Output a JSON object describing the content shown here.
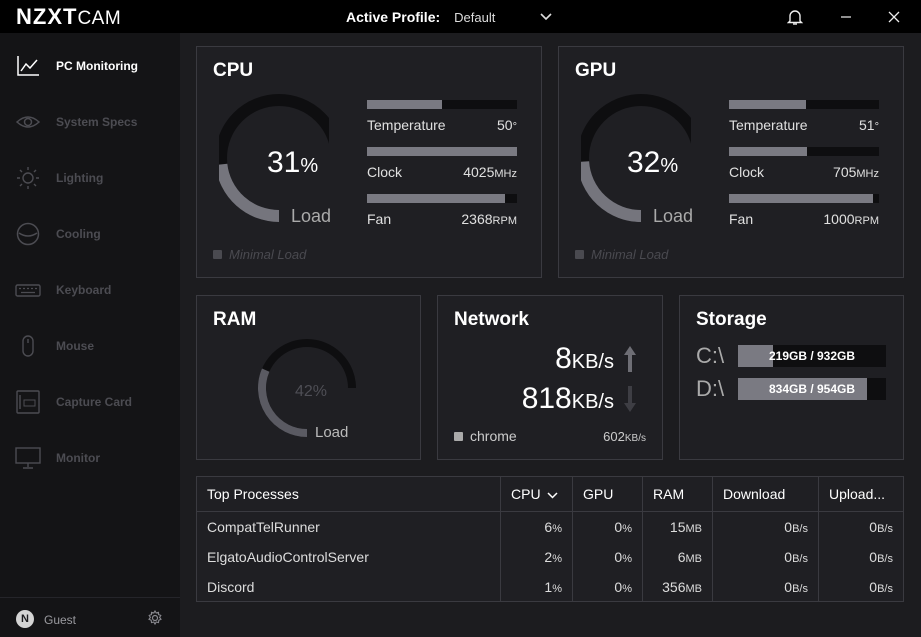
{
  "app": {
    "brand_bold": "NZXT",
    "brand_light": "CAM"
  },
  "profile": {
    "label": "Active Profile:",
    "value": "Default"
  },
  "sidebar": {
    "items": [
      {
        "label": "PC Monitoring",
        "icon": "chart-line-icon",
        "active": true
      },
      {
        "label": "System Specs",
        "icon": "eye-icon",
        "active": false
      },
      {
        "label": "Lighting",
        "icon": "sun-icon",
        "active": false
      },
      {
        "label": "Cooling",
        "icon": "cooling-icon",
        "active": false
      },
      {
        "label": "Keyboard",
        "icon": "keyboard-icon",
        "active": false
      },
      {
        "label": "Mouse",
        "icon": "mouse-icon",
        "active": false
      },
      {
        "label": "Capture Card",
        "icon": "capture-card-icon",
        "active": false
      },
      {
        "label": "Monitor",
        "icon": "monitor-icon",
        "active": false
      }
    ],
    "user": {
      "initial": "N",
      "name": "Guest"
    }
  },
  "cpu": {
    "title": "CPU",
    "load_value": "31",
    "load_unit": "%",
    "load_label": "Load",
    "load_fraction": 0.31,
    "temperature": {
      "label": "Temperature",
      "value": "50",
      "unit": "°",
      "fraction": 0.5
    },
    "clock": {
      "label": "Clock",
      "value": "4025",
      "unit": "MHz",
      "fraction": 1.0
    },
    "fan": {
      "label": "Fan",
      "value": "2368",
      "unit": "RPM",
      "fraction": 0.92
    },
    "mode": "Minimal Load"
  },
  "gpu": {
    "title": "GPU",
    "load_value": "32",
    "load_unit": "%",
    "load_label": "Load",
    "load_fraction": 0.32,
    "temperature": {
      "label": "Temperature",
      "value": "51",
      "unit": "°",
      "fraction": 0.51
    },
    "clock": {
      "label": "Clock",
      "value": "705",
      "unit": "MHz",
      "fraction": 0.52
    },
    "fan": {
      "label": "Fan",
      "value": "1000",
      "unit": "RPM",
      "fraction": 0.96
    },
    "mode": "Minimal Load"
  },
  "ram": {
    "title": "RAM",
    "load_value": "42%",
    "load_label": "Load",
    "load_fraction": 0.42
  },
  "network": {
    "title": "Network",
    "upload_value": "8",
    "upload_unit": "KB/s",
    "download_value": "818",
    "download_unit": "KB/s",
    "top_process": "chrome",
    "top_process_value": "602",
    "top_process_unit": "KB/s"
  },
  "storage": {
    "title": "Storage",
    "drives": [
      {
        "label": "C:\\",
        "text": "219GB / 932GB",
        "fraction": 0.235
      },
      {
        "label": "D:\\",
        "text": "834GB / 954GB",
        "fraction": 0.874
      }
    ]
  },
  "processes": {
    "headers": {
      "name": "Top Processes",
      "cpu": "CPU",
      "gpu": "GPU",
      "ram": "RAM",
      "download": "Download",
      "upload": "Upload..."
    },
    "rows": [
      {
        "name": "CompatTelRunner",
        "cpu": "6",
        "cpu_u": "%",
        "gpu": "0",
        "gpu_u": "%",
        "ram": "15",
        "ram_u": "MB",
        "down": "0",
        "down_u": "B/s",
        "up": "0",
        "up_u": "B/s"
      },
      {
        "name": "ElgatoAudioControlServer",
        "cpu": "2",
        "cpu_u": "%",
        "gpu": "0",
        "gpu_u": "%",
        "ram": "6",
        "ram_u": "MB",
        "down": "0",
        "down_u": "B/s",
        "up": "0",
        "up_u": "B/s"
      },
      {
        "name": "Discord",
        "cpu": "1",
        "cpu_u": "%",
        "gpu": "0",
        "gpu_u": "%",
        "ram": "356",
        "ram_u": "MB",
        "down": "0",
        "down_u": "B/s",
        "up": "0",
        "up_u": "B/s"
      }
    ]
  },
  "colors": {
    "accent_fill": "#7a7a82",
    "track": "#0e0e10",
    "background": "#1c1c1f",
    "card": "#1f1f23"
  }
}
